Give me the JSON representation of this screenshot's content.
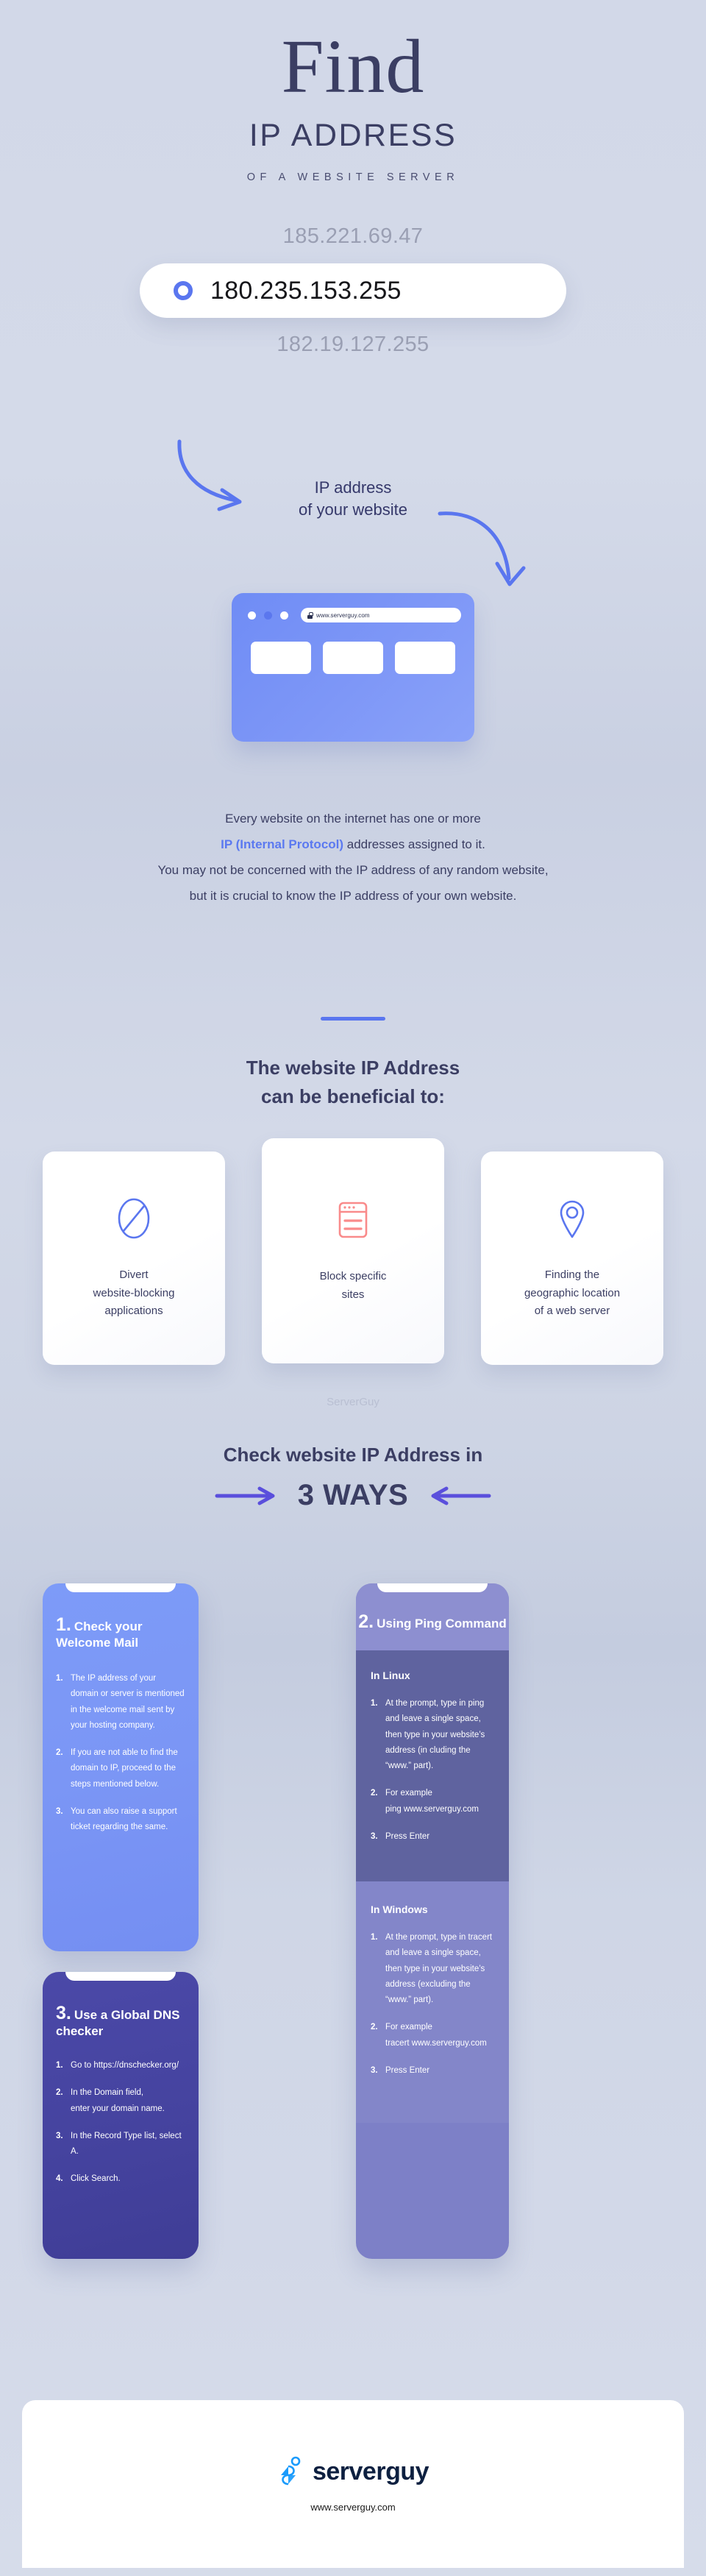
{
  "hero": {
    "title": "Find",
    "subtitle": "IP ADDRESS",
    "tagline": "OF A WEBSITE SERVER"
  },
  "ip_search": {
    "ghost_top": "185.221.69.47",
    "value": "180.235.153.255",
    "ghost_bottom": "182.19.127.255",
    "callout_line1": "IP address",
    "callout_line2": "of your website",
    "accent_color": "#5a76ef"
  },
  "browser": {
    "url": "www.serverguy.com",
    "lock_icon": "lock-icon"
  },
  "intro": {
    "line1": "Every website on the internet has one or more",
    "highlight": "IP (Internal Protocol)",
    "line2_rest": " addresses assigned to it.",
    "line3": "You may not be concerned with the IP address of any random website,",
    "line4": "but it is crucial to know the IP address of your own website."
  },
  "benefits_section": {
    "title_line1": "The website IP Address",
    "title_line2": "can be beneficial to:",
    "cards": [
      {
        "icon": "prohibited-icon",
        "icon_color": "#5a76ef",
        "text_line1": "Divert",
        "text_line2": "website-blocking",
        "text_line3": "applications"
      },
      {
        "icon": "browser-window-icon",
        "icon_color": "#f98b8b",
        "text_line1": "Block specific",
        "text_line2": "sites",
        "text_line3": ""
      },
      {
        "icon": "location-pin-icon",
        "icon_color": "#5a76ef",
        "text_line1": "Finding the",
        "text_line2": "geographic location",
        "text_line3": "of a web server"
      }
    ]
  },
  "watermark": "ServerGuy",
  "ways_section": {
    "title": "Check website IP Address in",
    "count_label": "3 WAYS",
    "arrow_left": "arrow-right-icon",
    "arrow_right": "arrow-left-icon",
    "arrow_color": "#5a4fdc"
  },
  "step_cards": [
    {
      "index": "1.",
      "title": "Check your Welcome Mail",
      "steps": [
        {
          "n": "1.",
          "t": "The IP address of your domain or server is mentioned in the welcome mail sent by your hosting company."
        },
        {
          "n": "2.",
          "t": "If you are not able to find the domain to IP, proceed to the steps mentioned below."
        },
        {
          "n": "3.",
          "t": "You can also raise a support ticket regarding the same."
        }
      ]
    },
    {
      "index": "2.",
      "title": "Using Ping Command",
      "linux": {
        "heading": "In Linux",
        "steps": [
          {
            "n": "1.",
            "t": "At the prompt, type in ping and leave a single space, then type in your website’s address (in cluding the “www.” part)."
          },
          {
            "n": "2.",
            "t": "For example\nping www.serverguy.com"
          },
          {
            "n": "3.",
            "t": "Press Enter"
          }
        ]
      },
      "windows": {
        "heading": "In Windows",
        "steps": [
          {
            "n": "1.",
            "t": "At the prompt, type in tracert and leave a single space, then type in your website’s address (excluding the “www.” part)."
          },
          {
            "n": "2.",
            "t": "For example\ntracert www.serverguy.com"
          },
          {
            "n": "3.",
            "t": "Press Enter"
          }
        ]
      }
    },
    {
      "index": "3.",
      "title": "Use a Global DNS checker",
      "steps": [
        {
          "n": "1.",
          "t": "Go to https://dnschecker.org/"
        },
        {
          "n": "2.",
          "t": "In the Domain field,\nenter your domain name."
        },
        {
          "n": "3.",
          "t": "In the Record Type list, select A."
        },
        {
          "n": "4.",
          "t": "Click Search."
        }
      ]
    }
  ],
  "footer": {
    "logo_mark": "serverguy-logo-icon",
    "logo_text": "serverguy",
    "url": "www.serverguy.com",
    "logo_accent": "#1a9bfc",
    "logo_dark": "#0d2040"
  }
}
